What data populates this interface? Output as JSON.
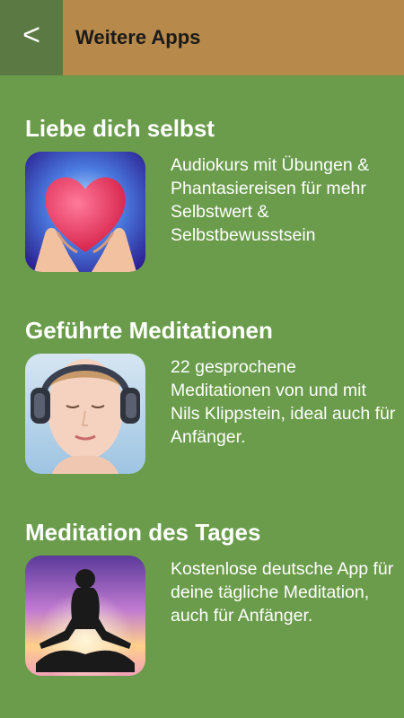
{
  "header": {
    "back_label": "<",
    "title": "Weitere Apps"
  },
  "apps": [
    {
      "title": "Liebe dich selbst",
      "description": "Audiokurs mit Übungen & Phantasiereisen für mehr Selbstwert & Selbstbewusstsein",
      "icon": "heart-in-hands-icon"
    },
    {
      "title": "Geführte Meditationen",
      "description": "22 gesprochene Meditationen von und mit Nils Klippstein, ideal auch für Anfänger.",
      "icon": "woman-headphones-icon"
    },
    {
      "title": "Meditation des Tages",
      "description": "Kostenlose deutsche App für deine tägliche Meditation, auch für Anfänger.",
      "icon": "meditation-silhouette-icon"
    }
  ],
  "colors": {
    "background": "#6a9c4b",
    "header": "#b7894b",
    "back_button": "#5b7a43"
  }
}
